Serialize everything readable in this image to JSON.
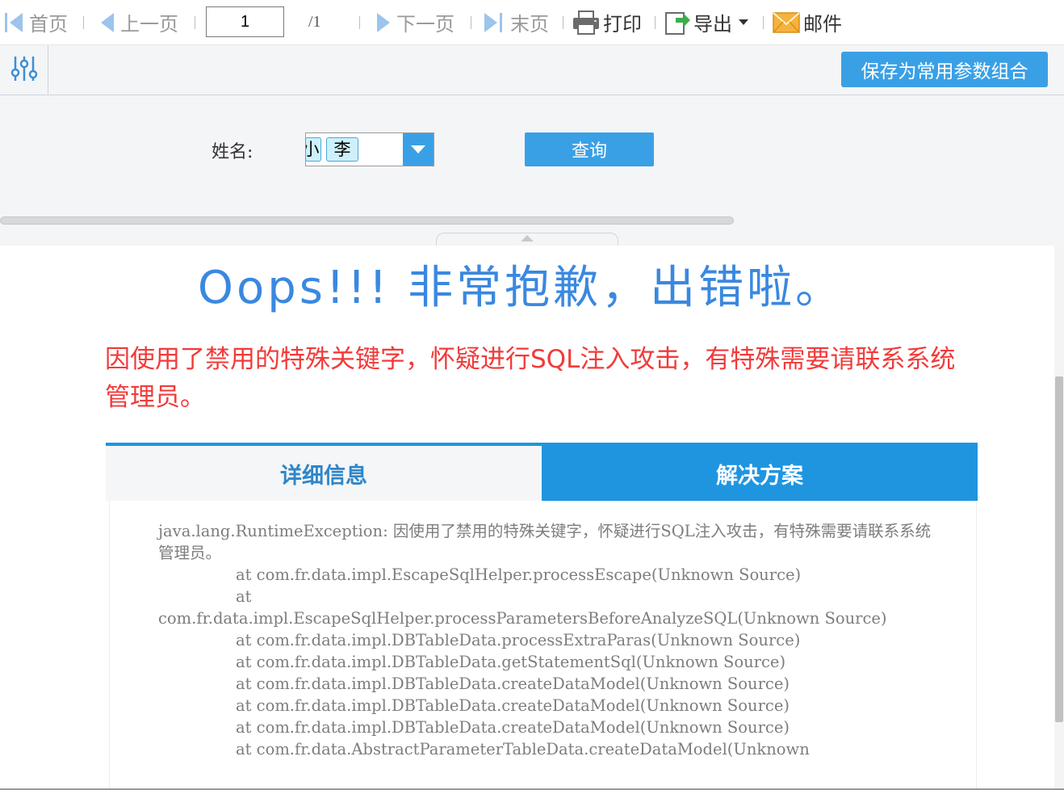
{
  "toolbar": {
    "first_label": "首页",
    "prev_label": "上一页",
    "page_value": "1",
    "page_total": "/1",
    "next_label": "下一页",
    "last_label": "末页",
    "print_label": "打印",
    "export_label": "导出",
    "mail_label": "邮件",
    "icons": [
      "first-page-icon",
      "prev-page-icon",
      "next-page-icon",
      "last-page-icon",
      "printer-icon",
      "export-icon",
      "dropdown-caret-icon",
      "mail-icon"
    ]
  },
  "params": {
    "toggle_icon": "sliders-icon",
    "save_label": "保存为常用参数组合",
    "name_label": "姓名:",
    "selected_tags": [
      "小",
      "李"
    ],
    "query_label": "查询"
  },
  "error": {
    "title": "Oops!!! 非常抱歉，出错啦。",
    "message": "因使用了禁用的特殊关键字，怀疑进行SQL注入攻击，有特殊需要请联系系统管理员。",
    "tabs": [
      "详细信息",
      "解决方案"
    ],
    "stack_head": "java.lang.RuntimeException: 因使用了禁用的特殊关键字，怀疑进行SQL注入攻击，有特殊需要请联系系统管理员。",
    "stack_lines": [
      "at com.fr.data.impl.EscapeSqlHelper.processEscape(Unknown Source)",
      "at",
      "com.fr.data.impl.EscapeSqlHelper.processParametersBeforeAnalyzeSQL(Unknown Source)",
      "at com.fr.data.impl.DBTableData.processExtraParas(Unknown Source)",
      "at com.fr.data.impl.DBTableData.getStatementSql(Unknown Source)",
      "at com.fr.data.impl.DBTableData.createDataModel(Unknown Source)",
      "at com.fr.data.impl.DBTableData.createDataModel(Unknown Source)",
      "at com.fr.data.impl.DBTableData.createDataModel(Unknown Source)",
      "at com.fr.data.AbstractParameterTableData.createDataModel(Unknown"
    ]
  },
  "colors": {
    "accent": "#3aa0e6",
    "tab_active": "#1f95e0",
    "title": "#3a88e0",
    "error_text": "#f23a3a",
    "stack_text": "#7d7d7d"
  }
}
